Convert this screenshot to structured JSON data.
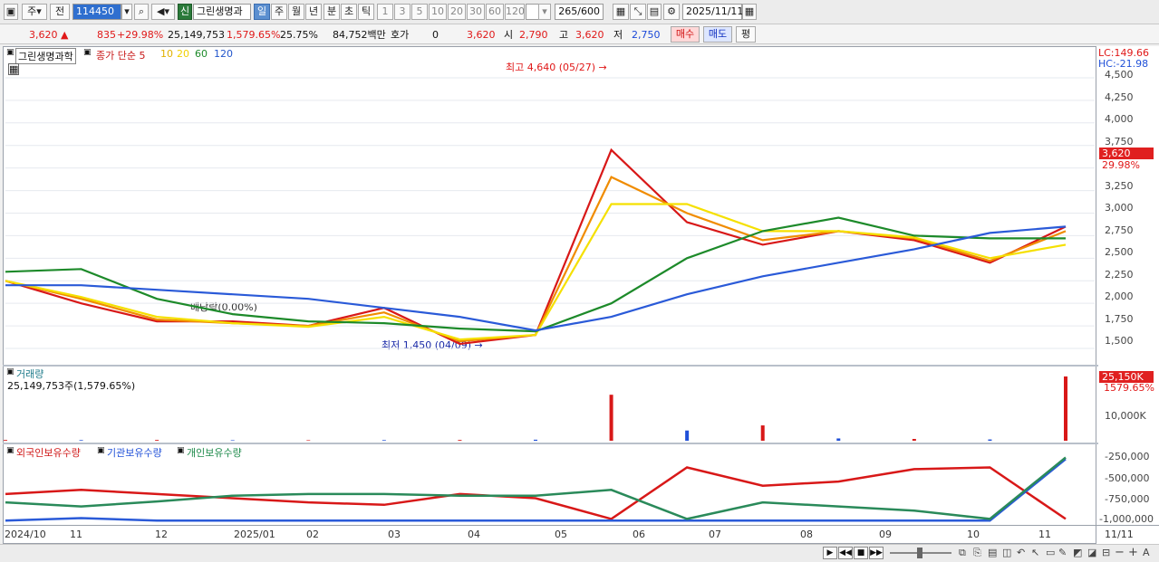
{
  "toolbar": {
    "period_label": "주",
    "prev_label": "전",
    "stock_code": "114450",
    "new_label": "신",
    "stock_name": "그린생명과",
    "periods": [
      "일",
      "주",
      "월",
      "년",
      "분",
      "초",
      "틱"
    ],
    "selected_period": "일",
    "intervals": [
      "1",
      "3",
      "5",
      "10",
      "20",
      "30",
      "60",
      "120"
    ],
    "count": "265",
    "count_total": "/600",
    "date": "2025/11/11"
  },
  "info": {
    "price": "3,620",
    "change": "835",
    "change_pct": "+29.98%",
    "volume": "25,149,753",
    "volume_pct": "1,579.65%",
    "turnover": "25.75%",
    "amount": "84,752백만",
    "hoga_label": "호가",
    "hoga_value": "0",
    "hoga_price": "3,620",
    "open_label": "시",
    "open_value": "2,790",
    "high_label": "고",
    "high_value": "3,620",
    "low_label": "저",
    "low_value": "2,750",
    "buy_label": "매수",
    "sell_label": "매도",
    "eval_label": "평"
  },
  "legend": {
    "name": "그린생명과학",
    "close_label": "종가 단순 5",
    "ma10": "10",
    "ma20": "20",
    "ma60": "60",
    "ma120": "120"
  },
  "annotations": {
    "high": "최고 4,640 (05/27)",
    "low": "최저 1,450 (04/09)",
    "dividend": "배당락(0.00%)"
  },
  "price_axis": {
    "lc": "LC:149.66",
    "hc": "HC:-21.98",
    "ticks": [
      "4,500",
      "4,250",
      "4,000",
      "3,750",
      "3,500",
      "3,250",
      "3,000",
      "2,750",
      "2,500",
      "2,250",
      "2,000",
      "1,750",
      "1,500"
    ],
    "current": "3,620",
    "current_pct": "29.98%"
  },
  "volume_panel": {
    "label": "거래량",
    "value": "25,149,753주(1,579.65%)",
    "tag": "25,150K",
    "tag_pct": "1579.65%",
    "tick": "10,000K"
  },
  "holding_panel": {
    "foreign": "외국인보유수량",
    "inst": "기관보유수량",
    "indiv": "개인보유수량",
    "ticks": [
      "-250,000",
      "-500,000",
      "-750,000",
      "-1,000,000"
    ]
  },
  "x_axis": [
    "2024/10",
    "11",
    "12",
    "2025/01",
    "02",
    "03",
    "04",
    "05",
    "06",
    "07",
    "08",
    "09",
    "10",
    "11",
    "11/11"
  ],
  "chart_data": [
    {
      "type": "line",
      "title": "그린생명과학",
      "x": [
        "2024/10",
        "11",
        "12",
        "2025/01",
        "02",
        "03",
        "04",
        "05",
        "06",
        "07",
        "08",
        "09",
        "10",
        "11",
        "11/11"
      ],
      "ylim": [
        1400,
        4640
      ],
      "series": [
        {
          "name": "종가 단순 5",
          "values": [
            2250,
            2000,
            1800,
            1800,
            1750,
            1950,
            1550,
            1650,
            3700,
            2900,
            2650,
            2800,
            2700,
            2450,
            2850
          ]
        },
        {
          "name": "10",
          "values": [
            2250,
            2050,
            1820,
            1780,
            1750,
            1900,
            1580,
            1650,
            3400,
            3000,
            2700,
            2800,
            2720,
            2470,
            2800
          ]
        },
        {
          "name": "20",
          "values": [
            2250,
            2070,
            1850,
            1780,
            1740,
            1850,
            1600,
            1650,
            3100,
            3100,
            2800,
            2800,
            2730,
            2500,
            2650
          ]
        },
        {
          "name": "60",
          "values": [
            2350,
            2380,
            2050,
            1880,
            1800,
            1780,
            1720,
            1690,
            2000,
            2500,
            2800,
            2950,
            2750,
            2720,
            2720
          ]
        },
        {
          "name": "120",
          "values": [
            2200,
            2200,
            2150,
            2100,
            2050,
            1950,
            1850,
            1700,
            1850,
            2100,
            2300,
            2450,
            2600,
            2780,
            2850
          ]
        }
      ]
    },
    {
      "type": "bar",
      "title": "거래량",
      "categories": [
        "2024/10",
        "11",
        "12",
        "2025/01",
        "02",
        "03",
        "04",
        "05",
        "06",
        "07",
        "08",
        "09",
        "10",
        "11",
        "11/11"
      ],
      "values": [
        300,
        250,
        300,
        200,
        200,
        250,
        300,
        400,
        18000,
        4000,
        6000,
        900,
        700,
        500,
        25150
      ],
      "unit": "K"
    },
    {
      "type": "line",
      "title": "보유수량",
      "x": [
        "2024/10",
        "11",
        "12",
        "2025/01",
        "02",
        "03",
        "04",
        "05",
        "06",
        "07",
        "08",
        "09",
        "10",
        "11",
        "11/11"
      ],
      "ylim": [
        -1050000,
        -200000
      ],
      "series": [
        {
          "name": "외국인보유수량",
          "values": [
            -700000,
            -650000,
            -700000,
            -750000,
            -800000,
            -830000,
            -700000,
            -750000,
            -1000000,
            -380000,
            -600000,
            -550000,
            -400000,
            -380000,
            -1000000
          ]
        },
        {
          "name": "기관보유수량",
          "values": [
            -1020000,
            -990000,
            -1020000,
            -1020000,
            -1020000,
            -1020000,
            -1020000,
            -1020000,
            -1020000,
            -1020000,
            -1020000,
            -1020000,
            -1020000,
            -1020000,
            -280000
          ]
        },
        {
          "name": "개인보유수량",
          "values": [
            -800000,
            -850000,
            -790000,
            -720000,
            -700000,
            -700000,
            -720000,
            -720000,
            -650000,
            -1000000,
            -800000,
            -850000,
            -900000,
            -1000000,
            -260000
          ]
        }
      ]
    }
  ]
}
